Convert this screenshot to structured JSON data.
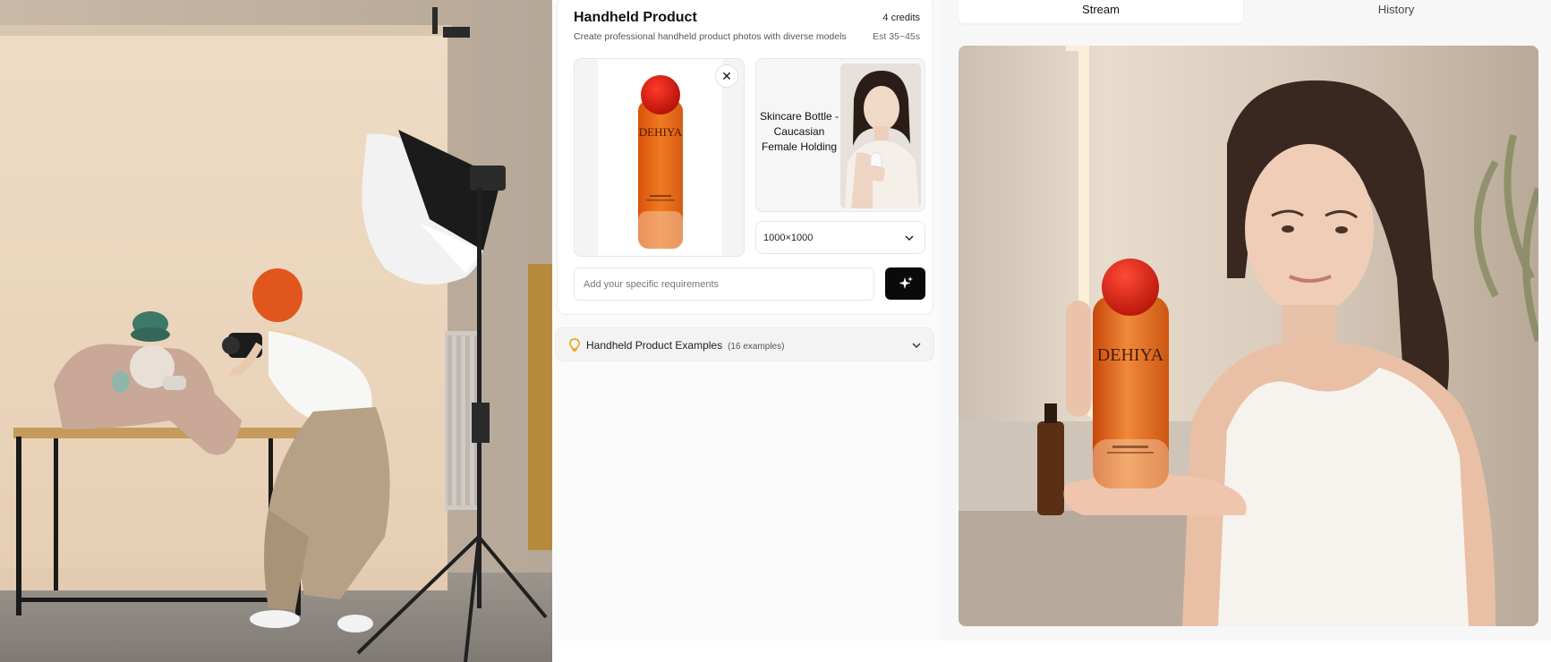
{
  "hero": {
    "image": "photographer-studio-scene"
  },
  "panel": {
    "title": "Handheld Product",
    "credits": "4 credits",
    "description": "Create professional handheld product photos with diverse models",
    "estimate": "Est 35~45s",
    "product_image": {
      "brand_text": "DEHIYA",
      "close_icon": "close-icon"
    },
    "model": {
      "label": "Skincare Bottle - Caucasian Female Holding"
    },
    "size_select": {
      "value": "1000×1000"
    },
    "requirements": {
      "placeholder": "Add your specific requirements",
      "value": ""
    },
    "generate_icon": "sparkle-icon"
  },
  "examples": {
    "title": "Handheld Product Examples",
    "count": "(16 examples)"
  },
  "tabs": [
    {
      "label": "Stream",
      "active": true
    },
    {
      "label": "History",
      "active": false
    }
  ],
  "result": {
    "brand_text": "DEHIYA"
  },
  "colors": {
    "accent": "#0a0a0a",
    "bottle_orange": "#e8620f",
    "cap_red": "#d81e10",
    "bulb": "#e0a100"
  }
}
